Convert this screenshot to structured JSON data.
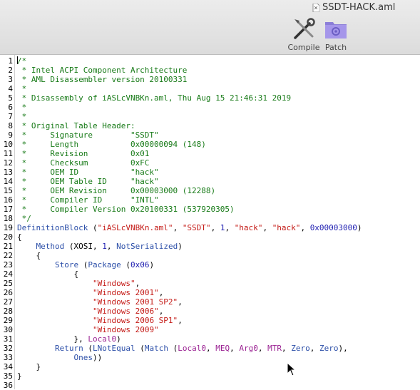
{
  "window": {
    "title": "SSDT-HACK.aml"
  },
  "toolbar": {
    "compile_label": "Compile",
    "patch_label": "Patch"
  },
  "code_lines": [
    [
      {
        "t": "/*",
        "c": "c-comment"
      }
    ],
    [
      {
        "t": " * Intel ACPI Component Architecture",
        "c": "c-comment"
      }
    ],
    [
      {
        "t": " * AML Disassembler version 20100331",
        "c": "c-comment"
      }
    ],
    [
      {
        "t": " *",
        "c": "c-comment"
      }
    ],
    [
      {
        "t": " * Disassembly of iASLcVNBKn.aml, Thu Aug 15 21:46:31 2019",
        "c": "c-comment"
      }
    ],
    [
      {
        "t": " *",
        "c": "c-comment"
      }
    ],
    [
      {
        "t": " *",
        "c": "c-comment"
      }
    ],
    [
      {
        "t": " * Original Table Header:",
        "c": "c-comment"
      }
    ],
    [
      {
        "t": " *     Signature        \"SSDT\"",
        "c": "c-comment"
      }
    ],
    [
      {
        "t": " *     Length           0x00000094 (148)",
        "c": "c-comment"
      }
    ],
    [
      {
        "t": " *     Revision         0x01",
        "c": "c-comment"
      }
    ],
    [
      {
        "t": " *     Checksum         0xFC",
        "c": "c-comment"
      }
    ],
    [
      {
        "t": " *     OEM ID           \"hack\"",
        "c": "c-comment"
      }
    ],
    [
      {
        "t": " *     OEM Table ID     \"hack\"",
        "c": "c-comment"
      }
    ],
    [
      {
        "t": " *     OEM Revision     0x00003000 (12288)",
        "c": "c-comment"
      }
    ],
    [
      {
        "t": " *     Compiler ID      \"INTL\"",
        "c": "c-comment"
      }
    ],
    [
      {
        "t": " *     Compiler Version 0x20100331 (537920305)",
        "c": "c-comment"
      }
    ],
    [
      {
        "t": " */",
        "c": "c-comment"
      }
    ],
    [
      {
        "t": "DefinitionBlock",
        "c": "c-kw"
      },
      {
        "t": " (",
        "c": "c-plain"
      },
      {
        "t": "\"iASLcVNBKn.aml\"",
        "c": "c-str"
      },
      {
        "t": ", ",
        "c": "c-plain"
      },
      {
        "t": "\"SSDT\"",
        "c": "c-str"
      },
      {
        "t": ", ",
        "c": "c-plain"
      },
      {
        "t": "1",
        "c": "c-num"
      },
      {
        "t": ", ",
        "c": "c-plain"
      },
      {
        "t": "\"hack\"",
        "c": "c-str"
      },
      {
        "t": ", ",
        "c": "c-plain"
      },
      {
        "t": "\"hack\"",
        "c": "c-str"
      },
      {
        "t": ", ",
        "c": "c-plain"
      },
      {
        "t": "0x00003000",
        "c": "c-num"
      },
      {
        "t": ")",
        "c": "c-plain"
      }
    ],
    [
      {
        "t": "{",
        "c": "c-plain"
      }
    ],
    [
      {
        "t": "    ",
        "c": "c-plain"
      },
      {
        "t": "Method",
        "c": "c-kw"
      },
      {
        "t": " (XOSI, ",
        "c": "c-plain"
      },
      {
        "t": "1",
        "c": "c-num"
      },
      {
        "t": ", ",
        "c": "c-plain"
      },
      {
        "t": "NotSerialized",
        "c": "c-kw"
      },
      {
        "t": ")",
        "c": "c-plain"
      }
    ],
    [
      {
        "t": "    {",
        "c": "c-plain"
      }
    ],
    [
      {
        "t": "        ",
        "c": "c-plain"
      },
      {
        "t": "Store",
        "c": "c-kw"
      },
      {
        "t": " (",
        "c": "c-plain"
      },
      {
        "t": "Package",
        "c": "c-kw"
      },
      {
        "t": " (",
        "c": "c-plain"
      },
      {
        "t": "0x06",
        "c": "c-num"
      },
      {
        "t": ")",
        "c": "c-plain"
      }
    ],
    [
      {
        "t": "            {",
        "c": "c-plain"
      }
    ],
    [
      {
        "t": "                ",
        "c": "c-plain"
      },
      {
        "t": "\"Windows\"",
        "c": "c-str"
      },
      {
        "t": ",",
        "c": "c-plain"
      }
    ],
    [
      {
        "t": "                ",
        "c": "c-plain"
      },
      {
        "t": "\"Windows 2001\"",
        "c": "c-str"
      },
      {
        "t": ",",
        "c": "c-plain"
      }
    ],
    [
      {
        "t": "                ",
        "c": "c-plain"
      },
      {
        "t": "\"Windows 2001 SP2\"",
        "c": "c-str"
      },
      {
        "t": ",",
        "c": "c-plain"
      }
    ],
    [
      {
        "t": "                ",
        "c": "c-plain"
      },
      {
        "t": "\"Windows 2006\"",
        "c": "c-str"
      },
      {
        "t": ",",
        "c": "c-plain"
      }
    ],
    [
      {
        "t": "                ",
        "c": "c-plain"
      },
      {
        "t": "\"Windows 2006 SP1\"",
        "c": "c-str"
      },
      {
        "t": ",",
        "c": "c-plain"
      }
    ],
    [
      {
        "t": "                ",
        "c": "c-plain"
      },
      {
        "t": "\"Windows 2009\"",
        "c": "c-str"
      }
    ],
    [
      {
        "t": "            }, ",
        "c": "c-plain"
      },
      {
        "t": "Local0",
        "c": "c-purple"
      },
      {
        "t": ")",
        "c": "c-plain"
      }
    ],
    [
      {
        "t": "        ",
        "c": "c-plain"
      },
      {
        "t": "Return",
        "c": "c-kw"
      },
      {
        "t": " (",
        "c": "c-plain"
      },
      {
        "t": "LNotEqual",
        "c": "c-kw"
      },
      {
        "t": " (",
        "c": "c-plain"
      },
      {
        "t": "Match",
        "c": "c-kw"
      },
      {
        "t": " (",
        "c": "c-plain"
      },
      {
        "t": "Local0",
        "c": "c-purple"
      },
      {
        "t": ", ",
        "c": "c-plain"
      },
      {
        "t": "MEQ",
        "c": "c-purple"
      },
      {
        "t": ", ",
        "c": "c-plain"
      },
      {
        "t": "Arg0",
        "c": "c-purple"
      },
      {
        "t": ", ",
        "c": "c-plain"
      },
      {
        "t": "MTR",
        "c": "c-purple"
      },
      {
        "t": ", ",
        "c": "c-plain"
      },
      {
        "t": "Zero",
        "c": "c-kw"
      },
      {
        "t": ", ",
        "c": "c-plain"
      },
      {
        "t": "Zero",
        "c": "c-kw"
      },
      {
        "t": "),",
        "c": "c-plain"
      }
    ],
    [
      {
        "t": "            ",
        "c": "c-plain"
      },
      {
        "t": "Ones",
        "c": "c-kw"
      },
      {
        "t": "))",
        "c": "c-plain"
      }
    ],
    [
      {
        "t": "    }",
        "c": "c-plain"
      }
    ],
    [
      {
        "t": "}",
        "c": "c-plain"
      }
    ],
    []
  ]
}
